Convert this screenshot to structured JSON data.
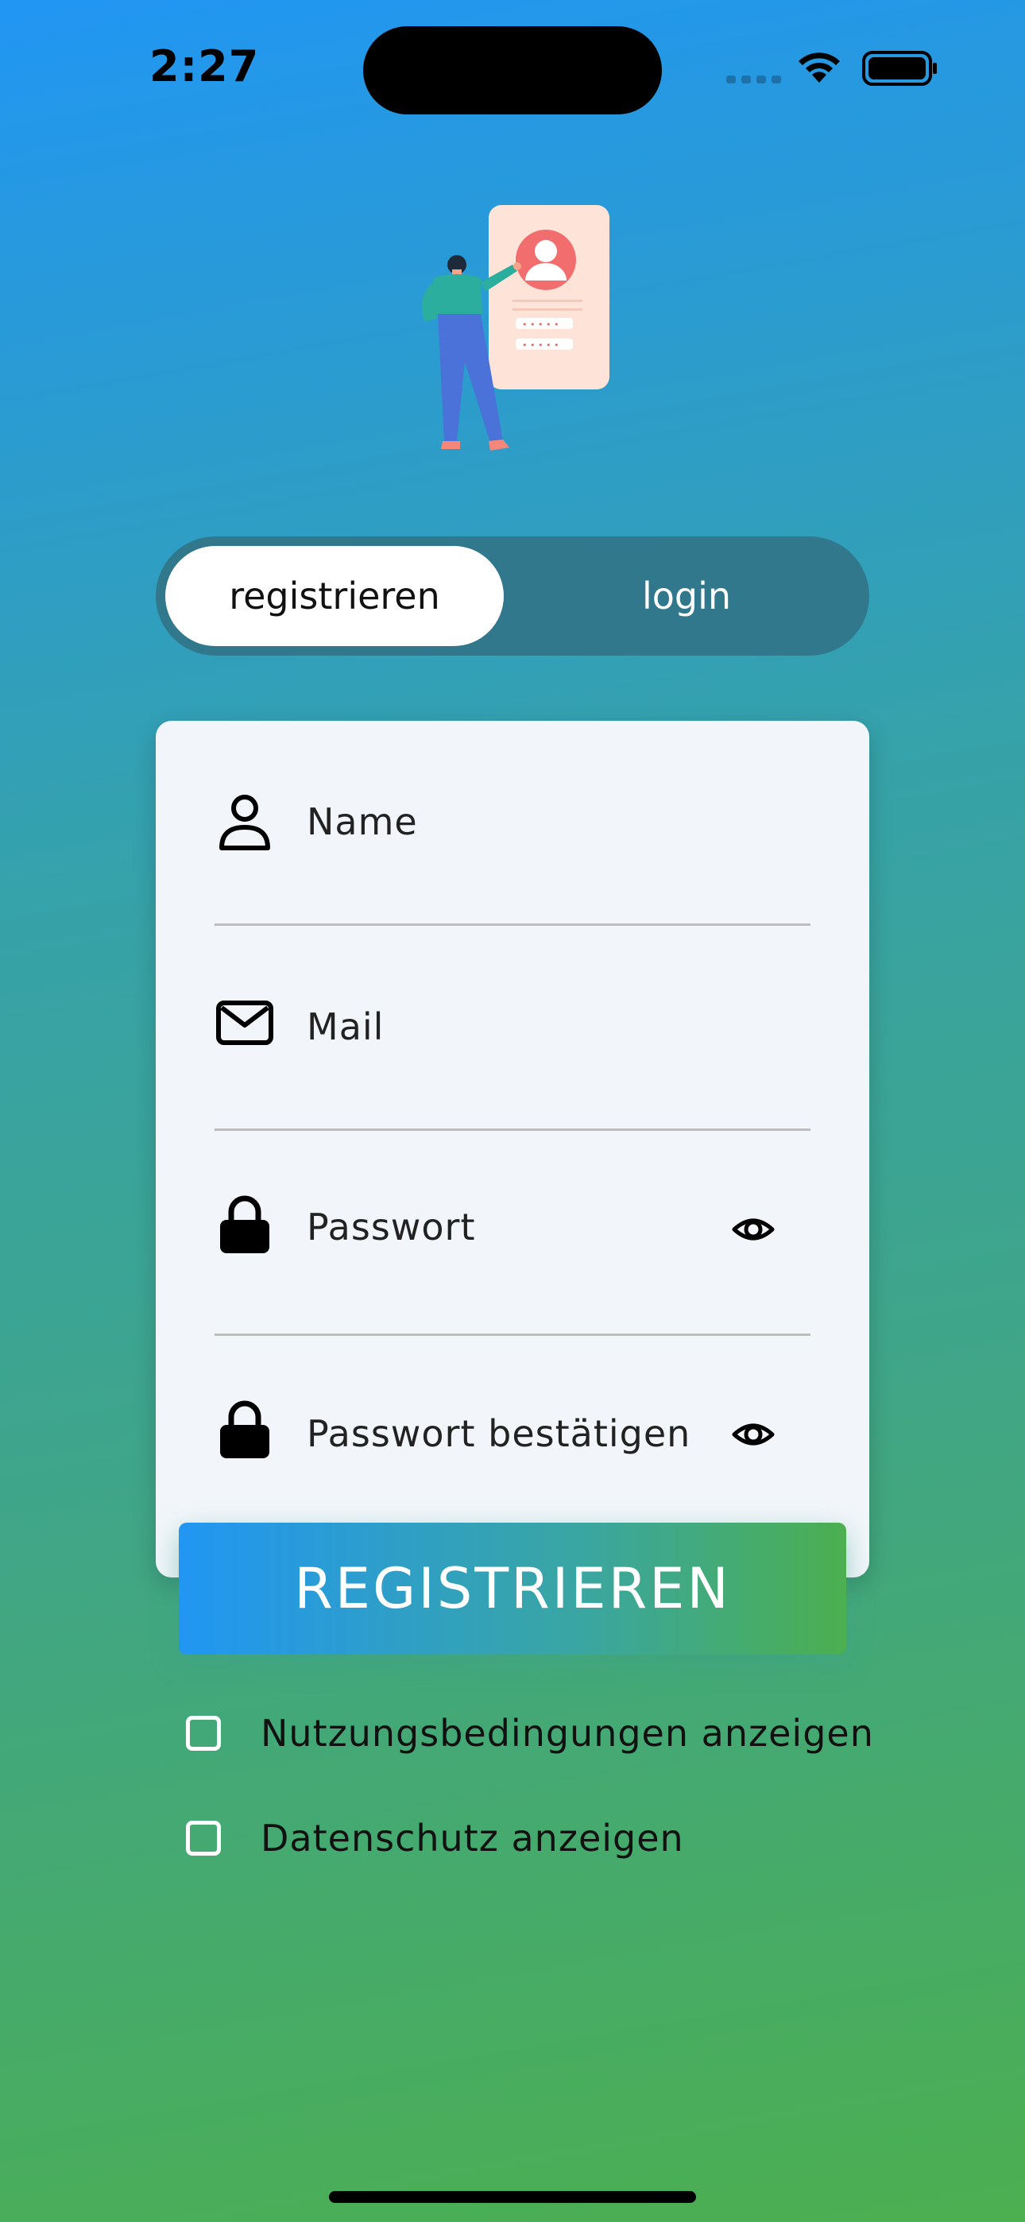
{
  "status_bar": {
    "time": "2:27"
  },
  "illustration": {
    "name": "person-with-profile-card-illustration",
    "password_mask": "• • • • •"
  },
  "tabs": {
    "active": "registrieren",
    "inactive": "login"
  },
  "form": {
    "fields": [
      {
        "label": "Name",
        "icon": "person-icon"
      },
      {
        "label": "Mail",
        "icon": "mail-icon"
      },
      {
        "label": "Passwort",
        "icon": "lock-icon",
        "toggle_icon": "eye-icon"
      },
      {
        "label": "Passwort bestätigen",
        "icon": "lock-icon",
        "toggle_icon": "eye-icon"
      }
    ]
  },
  "register_button": {
    "label": "REGISTRIEREN"
  },
  "checkboxes": [
    {
      "label": "Nutzungsbedingungen anzeigen",
      "checked": false
    },
    {
      "label": "Datenschutz anzeigen",
      "checked": false
    }
  ],
  "colors": {
    "gradient_top": "#2196F3",
    "gradient_bottom": "#4CAF50",
    "segmented_bg": "#31788C",
    "card_bg": "#F2F6FA"
  }
}
